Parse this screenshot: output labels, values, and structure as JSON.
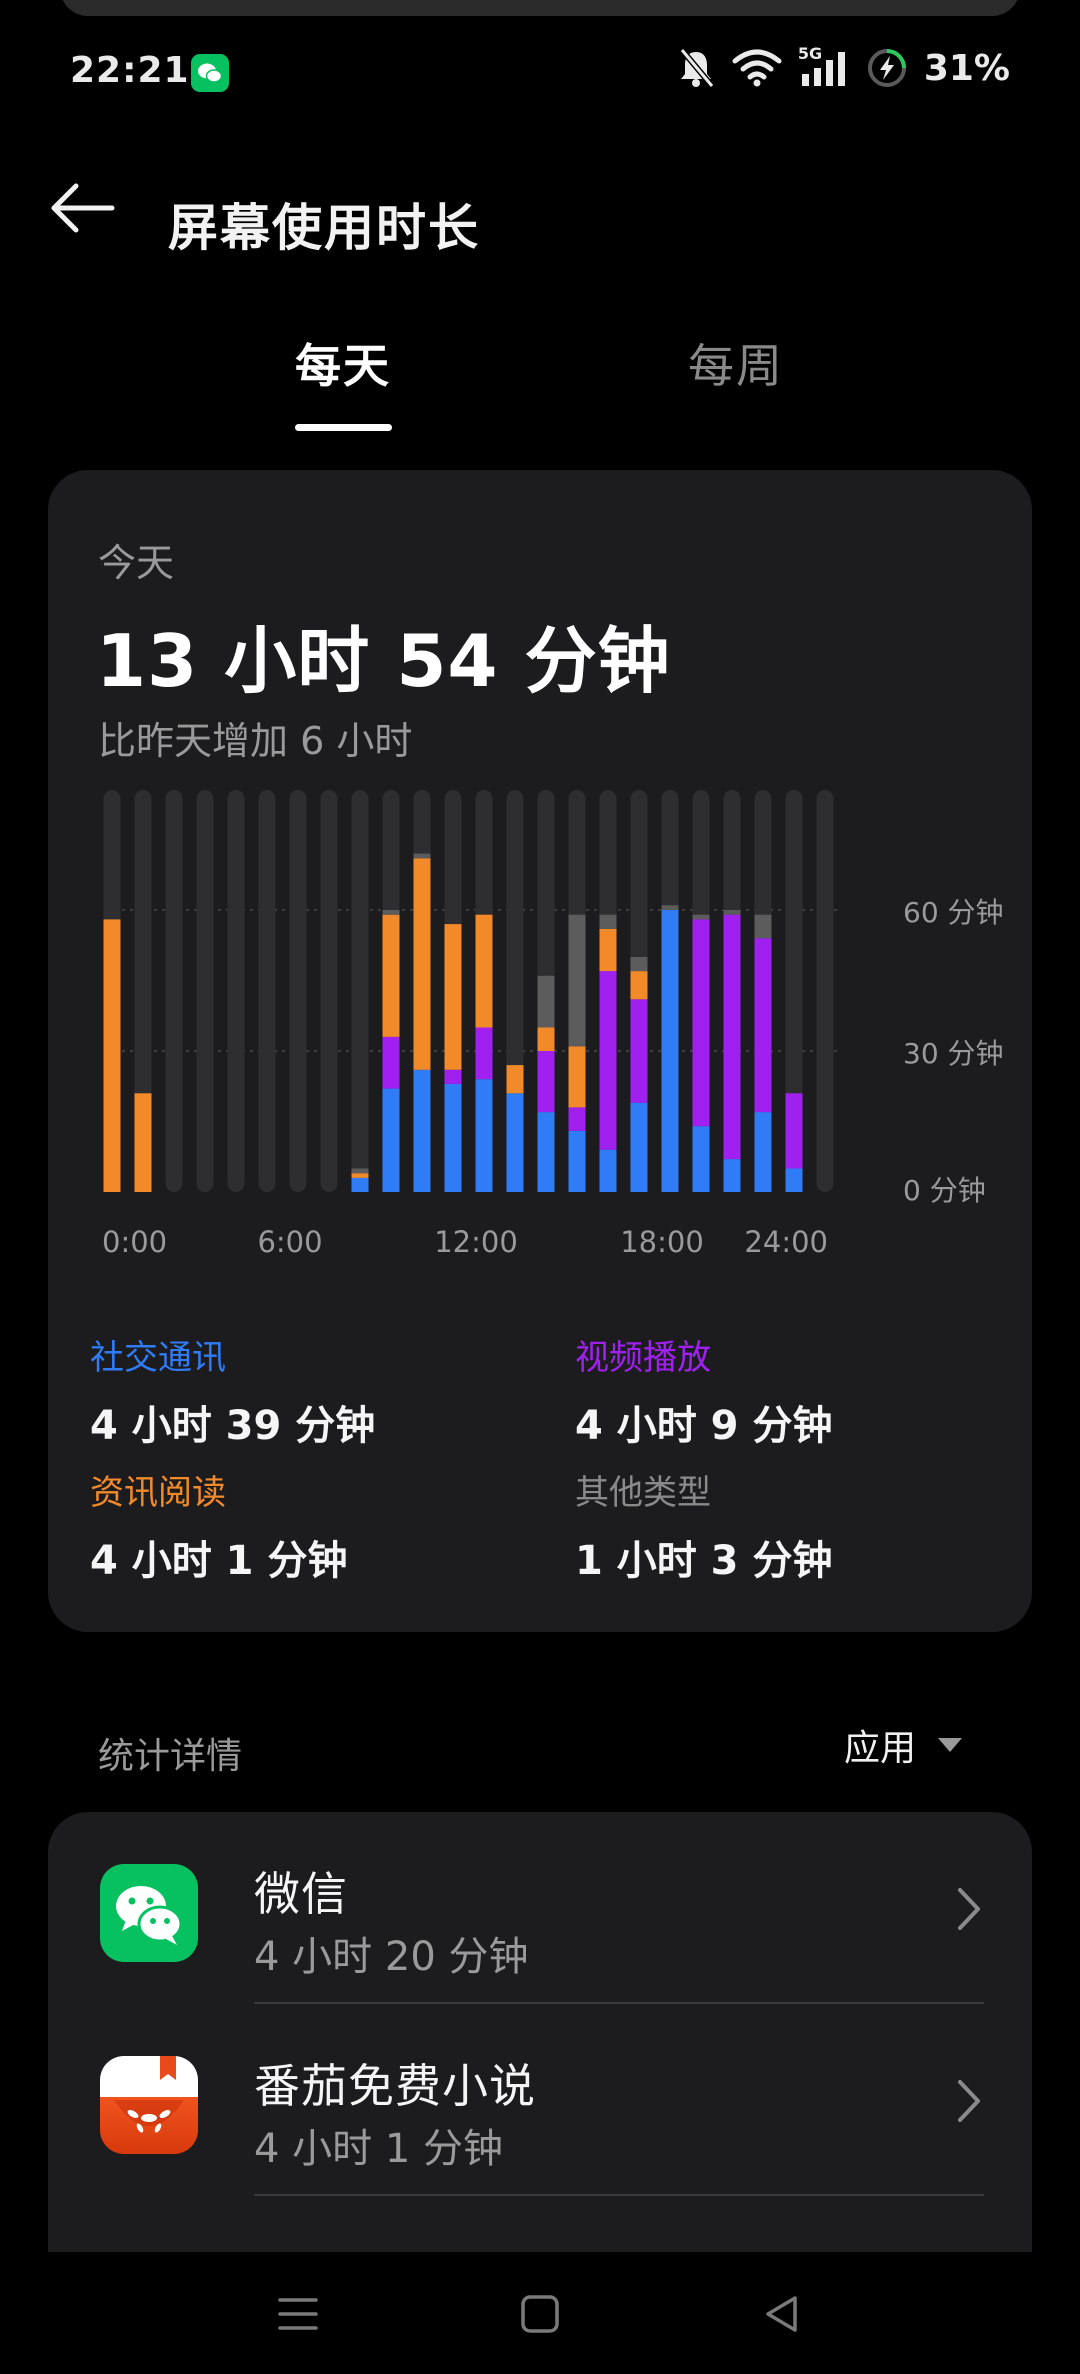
{
  "status_bar": {
    "time": "22:21",
    "notification_app_icon": "wechat-icon",
    "icons": [
      "bell-muted-icon",
      "wifi-icon",
      "5g-signal-icon",
      "battery-charging-icon"
    ],
    "network_label": "5G",
    "battery": "31%"
  },
  "header": {
    "back_icon": "arrow-left-icon",
    "title": "屏幕使用时长"
  },
  "tabs": [
    {
      "label": "每天",
      "active": true
    },
    {
      "label": "每周",
      "active": false
    }
  ],
  "summary": {
    "day_label": "今天",
    "total": "13 小时 54 分钟",
    "comparison": "比昨天增加 6 小时"
  },
  "chart_data": {
    "type": "bar",
    "stacked": true,
    "x_tick_labels": [
      "0:00",
      "6:00",
      "12:00",
      "18:00",
      "24:00"
    ],
    "y_tick_labels": [
      "60 分钟",
      "30 分钟",
      "0 分钟"
    ],
    "y_ticks": [
      60,
      30,
      0
    ],
    "ylim": [
      0,
      60
    ],
    "grid": true,
    "categories": [
      "0",
      "1",
      "2",
      "3",
      "4",
      "5",
      "6",
      "7",
      "8",
      "9",
      "10",
      "11",
      "12",
      "13",
      "14",
      "15",
      "16",
      "17",
      "18",
      "19",
      "20",
      "21",
      "22",
      "23"
    ],
    "series": [
      {
        "name": "社交通讯",
        "color": "#2f7cf6",
        "values": [
          0,
          0,
          0,
          0,
          0,
          0,
          0,
          0,
          3,
          22,
          26,
          23,
          24,
          21,
          17,
          13,
          9,
          19,
          60,
          14,
          7,
          17,
          5,
          0
        ]
      },
      {
        "name": "视频播放",
        "color": "#a020f0",
        "values": [
          0,
          0,
          0,
          0,
          0,
          0,
          0,
          0,
          0,
          11,
          0,
          3,
          11,
          0,
          13,
          5,
          38,
          22,
          0,
          44,
          52,
          37,
          16,
          0
        ]
      },
      {
        "name": "资讯阅读",
        "color": "#f28a2a",
        "values": [
          58,
          21,
          0,
          0,
          0,
          0,
          0,
          0,
          1,
          26,
          45,
          31,
          24,
          6,
          5,
          13,
          9,
          6,
          0,
          0,
          0,
          0,
          0,
          0
        ]
      },
      {
        "name": "其他类型",
        "color": "#5c5c5c",
        "values": [
          0,
          0,
          0,
          0,
          0,
          0,
          0,
          0,
          1,
          1,
          1,
          0,
          0,
          0,
          11,
          28,
          3,
          3,
          1,
          1,
          1,
          5,
          0,
          0
        ]
      }
    ]
  },
  "categories_breakdown": [
    {
      "label": "社交通讯",
      "value": "4 小时 39 分钟",
      "color": "#2f7cf6"
    },
    {
      "label": "视频播放",
      "value": "4 小时 9 分钟",
      "color": "#a020f0"
    },
    {
      "label": "资讯阅读",
      "value": "4 小时 1 分钟",
      "color": "#f28a2a"
    },
    {
      "label": "其他类型",
      "value": "1 小时 3 分钟",
      "color": "#8a8a8a"
    }
  ],
  "details": {
    "title": "统计详情",
    "filter_label": "应用",
    "filter_icon": "triangle-down-icon"
  },
  "apps": [
    {
      "name": "微信",
      "time": "4 小时 20 分钟",
      "icon": "wechat-app-icon"
    },
    {
      "name": "番茄免费小说",
      "time": "4 小时 1 分钟",
      "icon": "fanqie-novel-app-icon"
    }
  ],
  "nav": {
    "icons": [
      "menu-icon",
      "home-square-icon",
      "back-triangle-icon"
    ]
  }
}
